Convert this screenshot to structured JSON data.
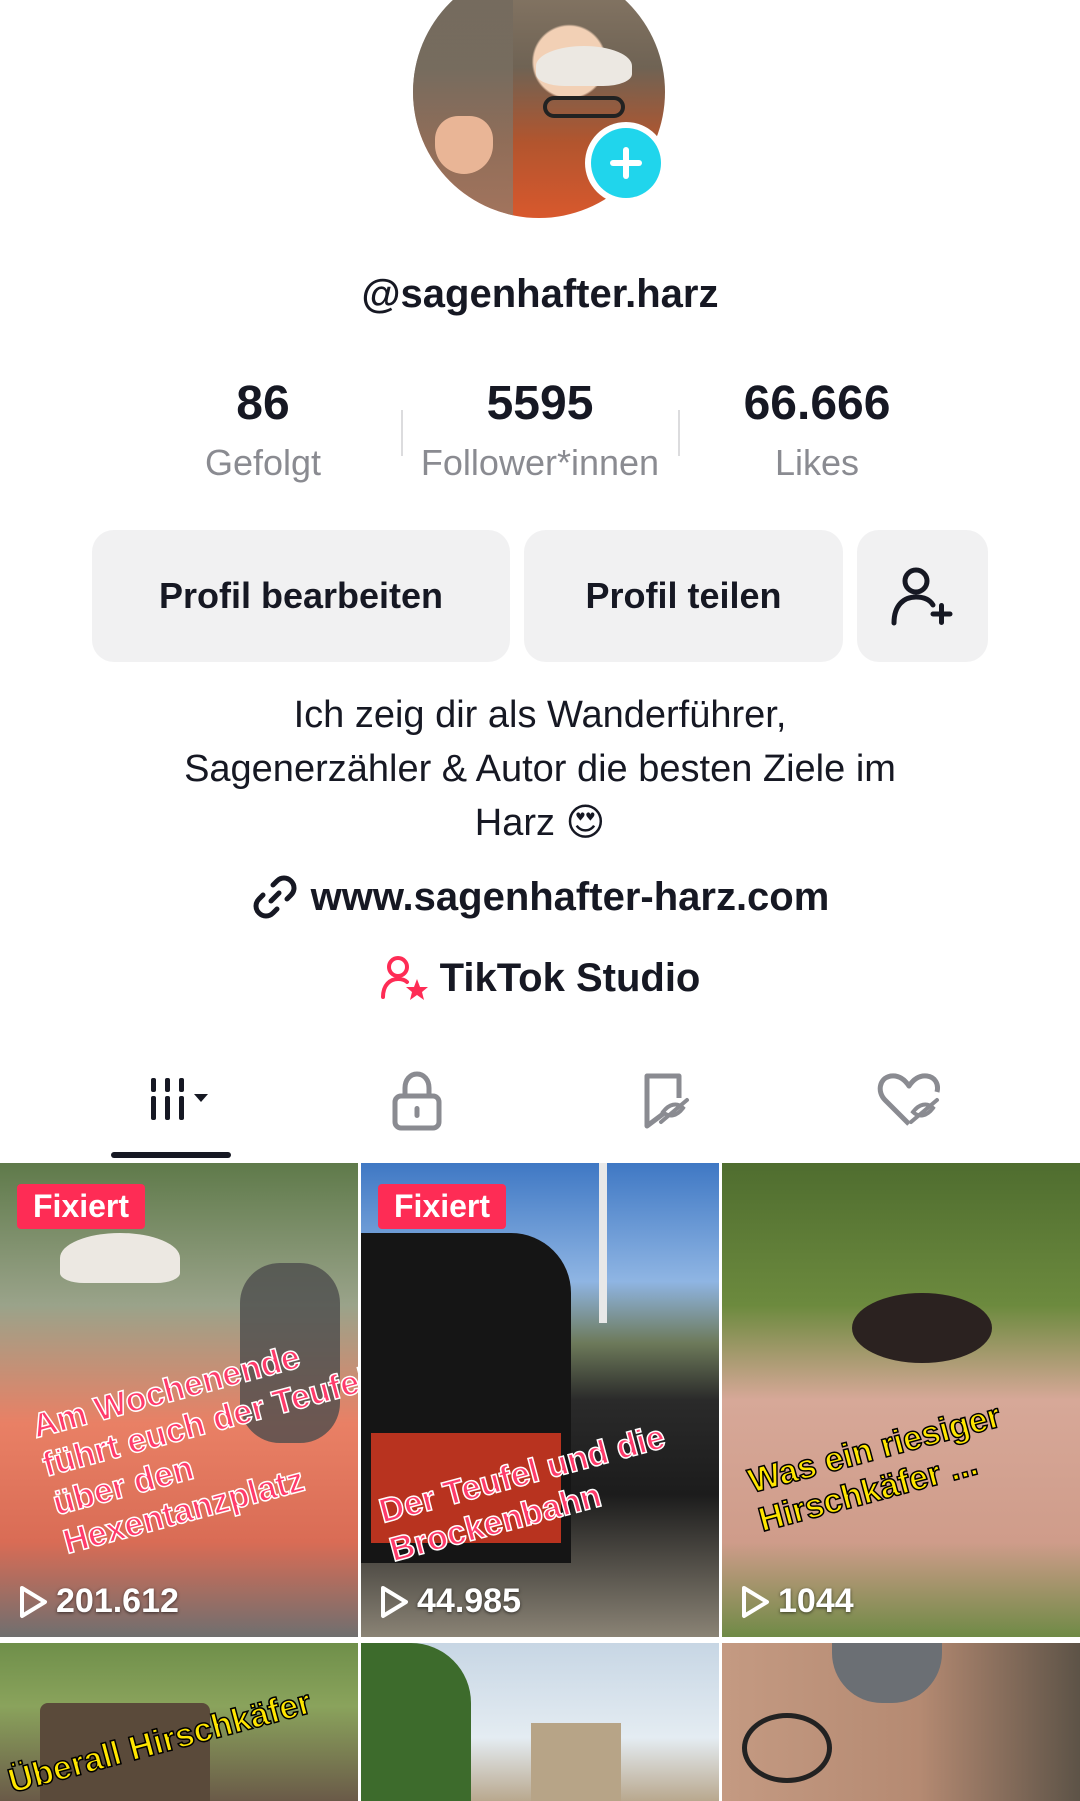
{
  "profile": {
    "username": "@sagenhafter.harz",
    "stats": [
      {
        "value": "86",
        "label": "Gefolgt"
      },
      {
        "value": "5595",
        "label": "Follower*innen"
      },
      {
        "value": "66.666",
        "label": "Likes"
      }
    ],
    "buttons": {
      "edit": "Profil bearbeiten",
      "share": "Profil teilen"
    },
    "bio_line1": "Ich zeig dir als Wanderführer,",
    "bio_line2": "Sagenerzähler & Autor die besten Ziele im",
    "bio_line3": "Harz 😍",
    "website": "www.sagenhafter-harz.com",
    "studio": "TikTok Studio"
  },
  "tabs": {
    "active": "videos",
    "items": [
      "videos",
      "private",
      "favorites",
      "liked"
    ]
  },
  "videos": [
    {
      "pinned": "Fixiert",
      "caption": "Am Wochenende führt euch der Teufel über den Hexentanzplatz",
      "views": "201.612"
    },
    {
      "pinned": "Fixiert",
      "caption": "Der Teufel und die Brockenbahn",
      "views": "44.985"
    },
    {
      "caption": "Was ein riesiger Hirschkäfer ...",
      "views": "1044"
    },
    {
      "caption": "Überall Hirschkäfer ..."
    },
    {},
    {}
  ],
  "colors": {
    "accent": "#20d5ec",
    "pin_badge": "#fe2c55",
    "studio_icon": "#fe2c55",
    "button_bg": "#f1f1f2",
    "muted_text": "#8a8b91"
  }
}
